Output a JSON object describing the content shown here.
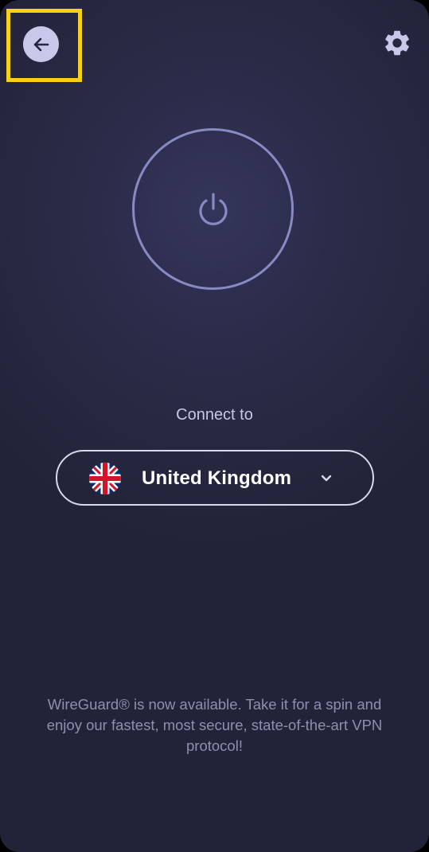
{
  "header": {
    "back_icon": "arrow-left-icon",
    "settings_icon": "gear-icon",
    "highlight_color": "#f7d117"
  },
  "power": {
    "icon": "power-icon",
    "ring_color": "#8b89c4"
  },
  "connect": {
    "label": "Connect to",
    "location": "United Kingdom",
    "flag_icon": "uk-flag-icon",
    "dropdown_icon": "chevron-down-icon"
  },
  "footer": {
    "notice": "WireGuard® is now available. Take it for a spin and enjoy our fastest, most secure, state-of-the-art VPN protocol!"
  },
  "colors": {
    "background": "#2a2b47",
    "accent": "#c9c8ea"
  }
}
